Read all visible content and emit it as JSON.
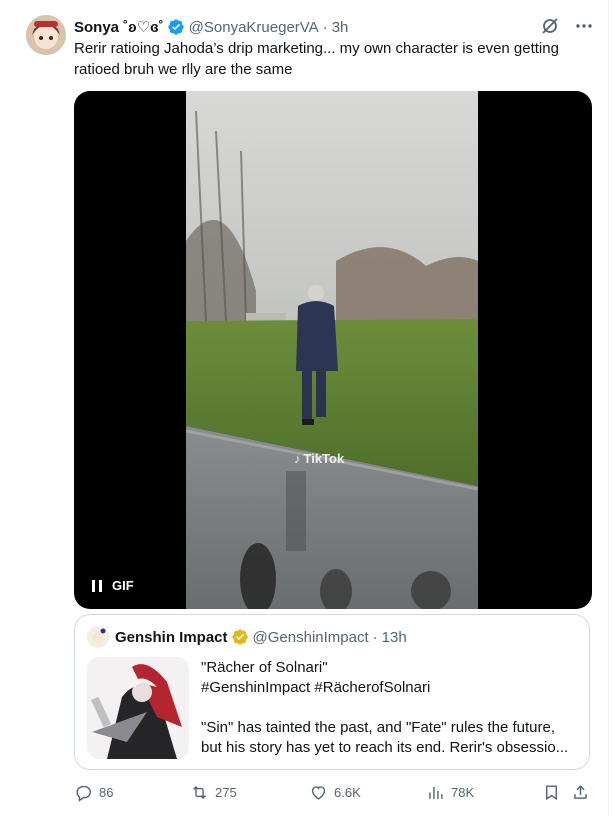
{
  "tweet": {
    "author": {
      "display_name": "Sonya ˚ʚ♡ɞ˚",
      "handle": "@SonyaKruegerVA",
      "time": "3h",
      "verified": true
    },
    "separator": "·",
    "text": "Rerir ratioing Jahoda’s drip marketing... my own character is even getting ratioed bruh we rlly are the same",
    "media": {
      "type": "GIF",
      "badge_label": "GIF",
      "watermark": "TikTok",
      "state": "playing",
      "pause_icon": "pause-icon"
    },
    "quote": {
      "author": {
        "display_name": "Genshin Impact",
        "handle": "@GenshinImpact",
        "time": "13h",
        "verified_color": "gold"
      },
      "lines": [
        "\"Rächer of Solnari\"",
        "#GenshinImpact #RächerofSolnari",
        "",
        "\"Sin\" has tainted the past, and \"Fate\" rules the future,",
        "but his story has yet to reach its end. Rerir's obsessio..."
      ]
    },
    "actions": {
      "replies": "86",
      "reposts": "275",
      "likes": "6.6K",
      "views": "78K"
    }
  },
  "colors": {
    "text": "#0f1419",
    "secondary": "#536471",
    "verified_blue": "#1d9bf0",
    "verified_gold": "#e2b719",
    "border": "#cfd9de",
    "media_bg": "#000000"
  }
}
